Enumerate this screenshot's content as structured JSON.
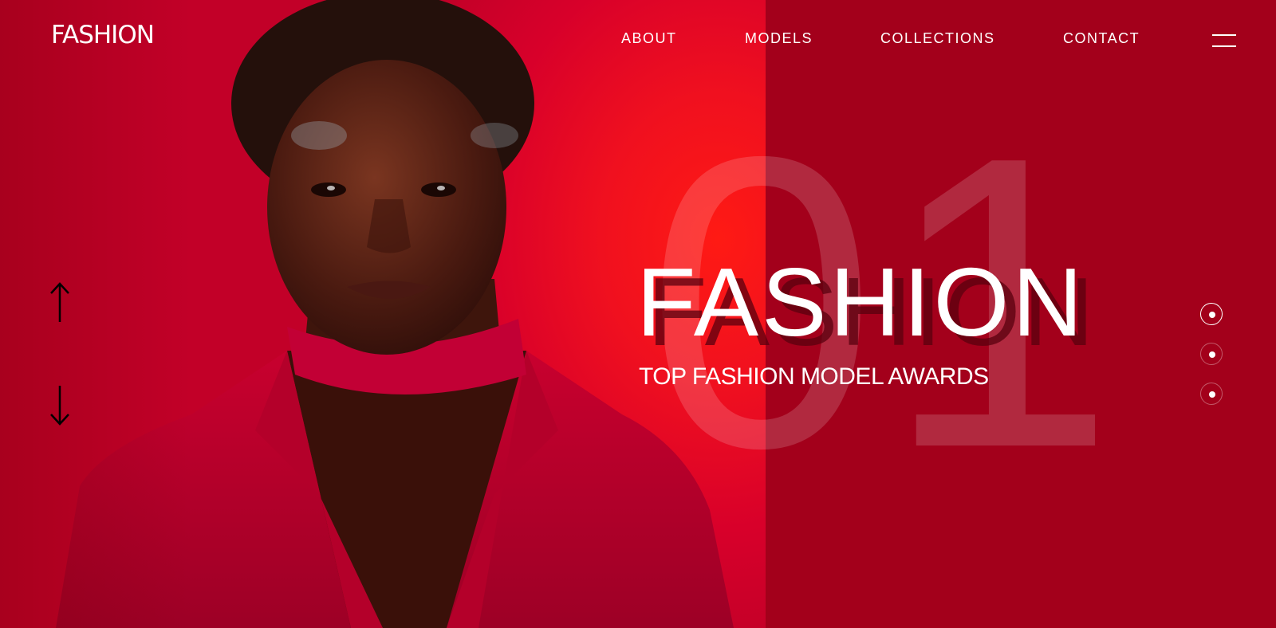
{
  "brand": {
    "logo_text": "FASHION"
  },
  "nav": {
    "items": [
      {
        "label": "ABOUT"
      },
      {
        "label": "MODELS"
      },
      {
        "label": "COLLECTIONS"
      },
      {
        "label": "CONTACT"
      }
    ],
    "menu_icon": "hamburger-menu-icon"
  },
  "hero": {
    "slide_number": "01",
    "title": "FASHION",
    "subtitle": "TOP FASHION MODEL AWARDS",
    "slider_arrows": [
      "arrow-up-icon",
      "arrow-down-icon"
    ],
    "pagination": {
      "total": 3,
      "active_index": 0
    }
  },
  "colors": {
    "left_panel": "#e0001f",
    "right_panel": "#a3001b",
    "text": "#ffffff"
  }
}
